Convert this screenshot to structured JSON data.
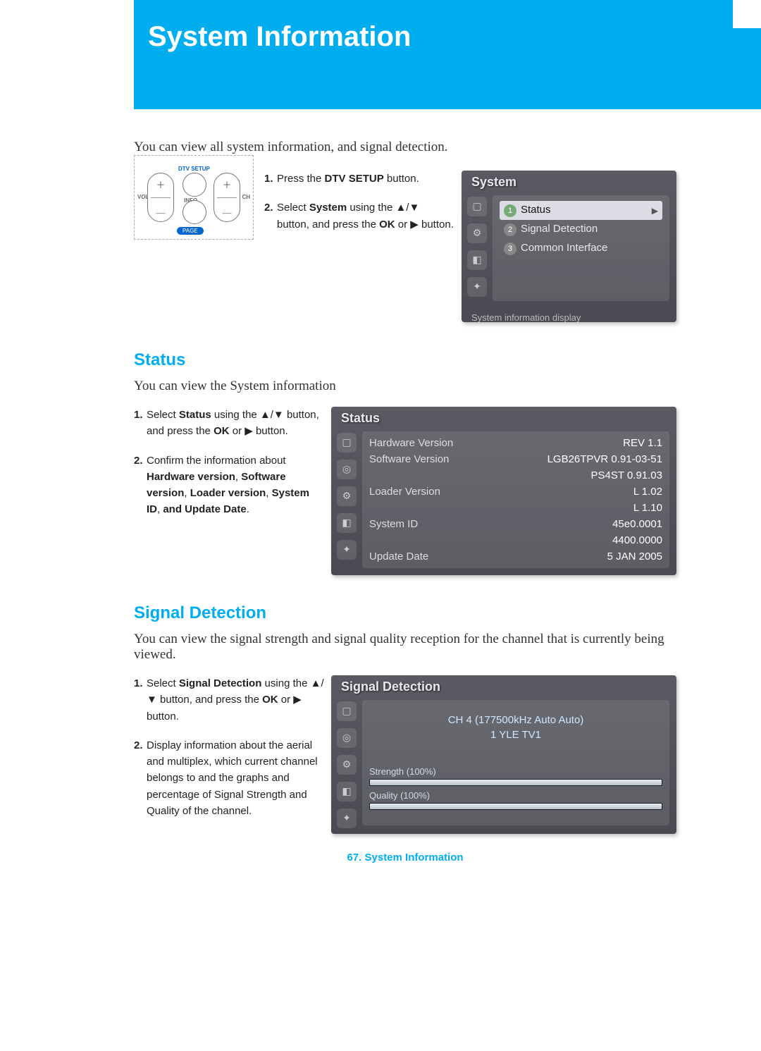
{
  "header": {
    "title": "System Information"
  },
  "intro": "You can view all system information, and signal detection.",
  "remote": {
    "setup_label": "DTV SETUP",
    "info_label": "INFO",
    "vol_label": "VOL",
    "ch_label": "CH",
    "page_label": "PAGE"
  },
  "steps_main": {
    "s1_pre": "Press the ",
    "s1_b": "DTV SETUP",
    "s1_post": " button.",
    "s2_pre": "Select ",
    "s2_b": "System",
    "s2_mid": " using the ▲/▼ button, and press the ",
    "s2_b2": "OK",
    "s2_post": " or ▶ button."
  },
  "osd_system": {
    "title": "System",
    "items": [
      {
        "num": "1",
        "label": "Status",
        "selected": true
      },
      {
        "num": "2",
        "label": "Signal Detection",
        "selected": false
      },
      {
        "num": "3",
        "label": "Common Interface",
        "selected": false
      }
    ],
    "hint": "System information display"
  },
  "section_status": {
    "heading": "Status",
    "caption": "You can view the System information",
    "s1_pre": "Select ",
    "s1_b": "Status",
    "s1_mid": " using the ▲/▼ button, and press the ",
    "s1_b2": "OK",
    "s1_post": " or ▶ button.",
    "s2_pre": "Confirm the information about ",
    "s2_b1": "Hardware version",
    "s2_c1": ", ",
    "s2_b2": "Software version",
    "s2_c2": ", ",
    "s2_b3": "Loader version",
    "s2_c3": ", ",
    "s2_b4": "System ID",
    "s2_c4": ", ",
    "s2_b5": "and Update Date",
    "s2_post": "."
  },
  "osd_status": {
    "title": "Status",
    "rows": [
      {
        "k": "Hardware Version",
        "v": "REV 1.1"
      },
      {
        "k": "Software Version",
        "v": "LGB26TPVR 0.91-03-51"
      },
      {
        "k": "",
        "v": "PS4ST 0.91.03"
      },
      {
        "k": "Loader Version",
        "v": "L 1.02"
      },
      {
        "k": "",
        "v": "L 1.10"
      },
      {
        "k": "System ID",
        "v": "45e0.0001"
      },
      {
        "k": "",
        "v": "4400.0000"
      },
      {
        "k": "Update Date",
        "v": "5 JAN 2005"
      }
    ]
  },
  "section_signal": {
    "heading": "Signal Detection",
    "caption": "You can view the signal strength and signal quality reception for the channel that is currently being viewed.",
    "s1_pre": "Select ",
    "s1_b": "Signal Detection",
    "s1_mid": " using the ▲/▼ button, and press the ",
    "s1_b2": "OK",
    "s1_post": " or ▶ button.",
    "s2": "Display information about the aerial and multiplex, which current channel belongs to and the graphs and percentage of Signal Strength and Quality of the channel."
  },
  "osd_signal": {
    "title": "Signal Detection",
    "ch_line": "CH 4 (177500kHz Auto Auto)",
    "ch_sub": "1 YLE TV1",
    "strength_label": "Strength (100%)",
    "quality_label": "Quality (100%)",
    "strength_pct": 100,
    "quality_pct": 100
  },
  "footer": {
    "page_num": "67.",
    "label": "System Information"
  }
}
